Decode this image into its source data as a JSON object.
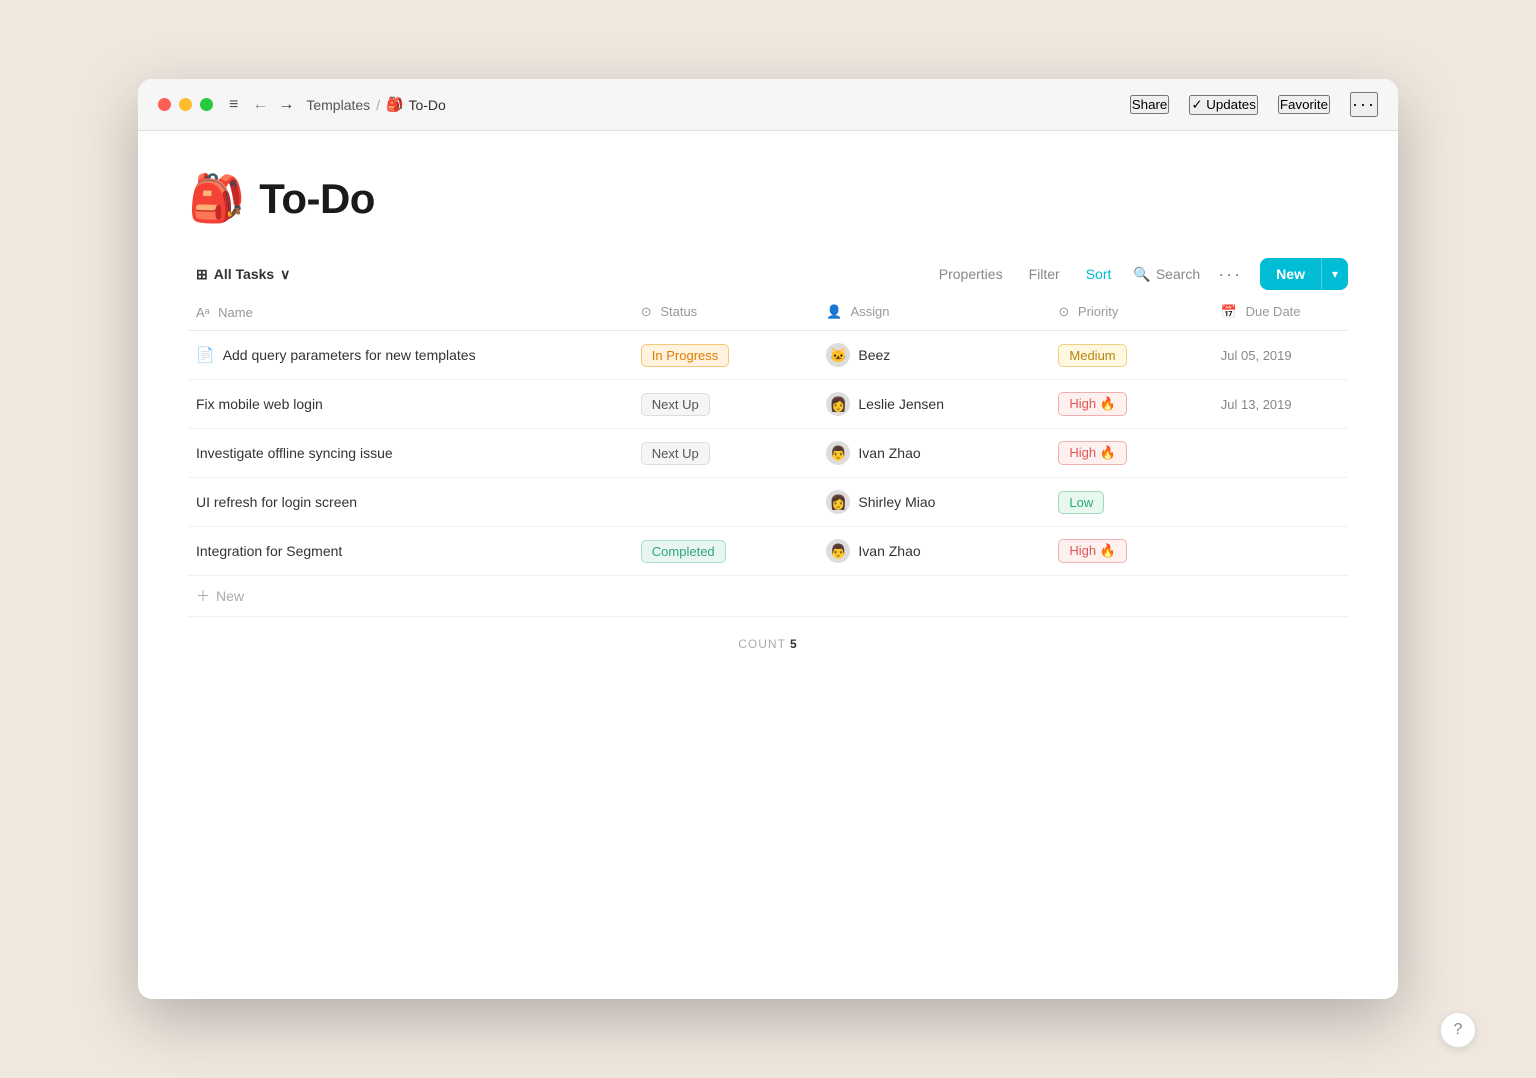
{
  "window": {
    "title": "To-Do"
  },
  "titlebar": {
    "breadcrumb_parent": "Templates",
    "breadcrumb_sep": "/",
    "breadcrumb_current_emoji": "🎒",
    "breadcrumb_current": "To-Do",
    "actions": {
      "share": "Share",
      "updates": "✓ Updates",
      "favorite": "Favorite",
      "more": "···"
    }
  },
  "page": {
    "emoji": "🎒",
    "title": "To-Do"
  },
  "toolbar": {
    "all_tasks": "All Tasks",
    "properties": "Properties",
    "filter": "Filter",
    "sort": "Sort",
    "search": "Search",
    "new": "New"
  },
  "table": {
    "columns": [
      {
        "id": "name",
        "icon": "Aa",
        "label": "Name"
      },
      {
        "id": "status",
        "icon": "⊙",
        "label": "Status"
      },
      {
        "id": "assign",
        "icon": "👤",
        "label": "Assign"
      },
      {
        "id": "priority",
        "icon": "⊙",
        "label": "Priority"
      },
      {
        "id": "duedate",
        "icon": "📅",
        "label": "Due Date"
      }
    ],
    "rows": [
      {
        "id": 1,
        "name": "Add query parameters for new templates",
        "status": "In Progress",
        "status_type": "in-progress",
        "assignee": "Beez",
        "assignee_avatar": "🐱",
        "priority": "Medium",
        "priority_type": "medium",
        "due_date": "Jul 05, 2019",
        "has_doc_icon": true
      },
      {
        "id": 2,
        "name": "Fix mobile web login",
        "status": "Next Up",
        "status_type": "next-up",
        "assignee": "Leslie Jensen",
        "assignee_avatar": "👩",
        "priority": "High 🔥",
        "priority_type": "high",
        "due_date": "Jul 13, 2019",
        "has_doc_icon": false
      },
      {
        "id": 3,
        "name": "Investigate offline syncing issue",
        "status": "Next Up",
        "status_type": "next-up",
        "assignee": "Ivan Zhao",
        "assignee_avatar": "👨",
        "priority": "High 🔥",
        "priority_type": "high",
        "due_date": "",
        "has_doc_icon": false
      },
      {
        "id": 4,
        "name": "UI refresh for login screen",
        "status": "",
        "status_type": "",
        "assignee": "Shirley Miao",
        "assignee_avatar": "👩",
        "priority": "Low",
        "priority_type": "low",
        "due_date": "",
        "has_doc_icon": false
      },
      {
        "id": 5,
        "name": "Integration for Segment",
        "status": "Completed",
        "status_type": "completed",
        "assignee": "Ivan Zhao",
        "assignee_avatar": "👨",
        "priority": "High 🔥",
        "priority_type": "high",
        "due_date": "",
        "has_doc_icon": false
      }
    ],
    "add_new_label": "New",
    "count_label": "COUNT",
    "count_value": "5"
  },
  "help_btn_label": "?"
}
